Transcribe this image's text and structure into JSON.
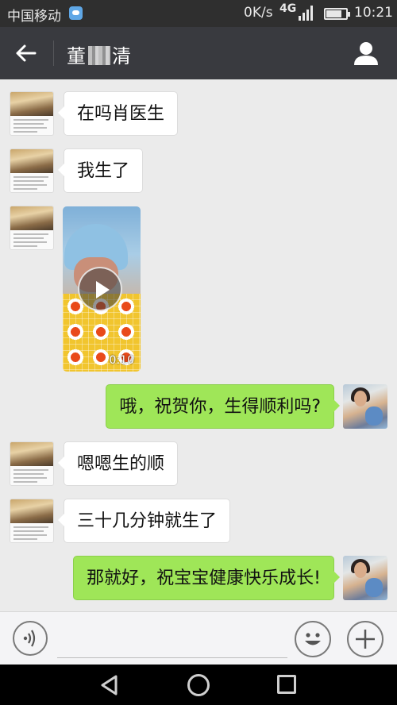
{
  "status_bar": {
    "carrier": "中国移动",
    "speed": "0K/s",
    "network": "4G",
    "time": "10:21",
    "battery_level": 0.8
  },
  "header": {
    "contact_name_before": "董",
    "contact_name_after": "清"
  },
  "messages": [
    {
      "sender": "contact",
      "text": "在吗肖医生"
    },
    {
      "sender": "contact",
      "text": "我生了"
    },
    {
      "sender": "contact",
      "type": "video",
      "duration": "0:10"
    },
    {
      "sender": "me",
      "text": "哦，祝贺你，生得顺利吗?"
    },
    {
      "sender": "contact",
      "text": "嗯嗯生的顺"
    },
    {
      "sender": "contact",
      "text": "三十几分钟就生了"
    },
    {
      "sender": "me",
      "text": "那就好，祝宝宝健康快乐成长!"
    }
  ],
  "input_bar": {
    "placeholder": "",
    "icons": [
      "voice-icon",
      "emoji-icon",
      "plus-icon"
    ]
  },
  "colors": {
    "titlebar": "#393a3f",
    "outgoing_bubble": "#9fe658",
    "incoming_bubble": "#ffffff",
    "chat_background": "#ebebeb"
  }
}
